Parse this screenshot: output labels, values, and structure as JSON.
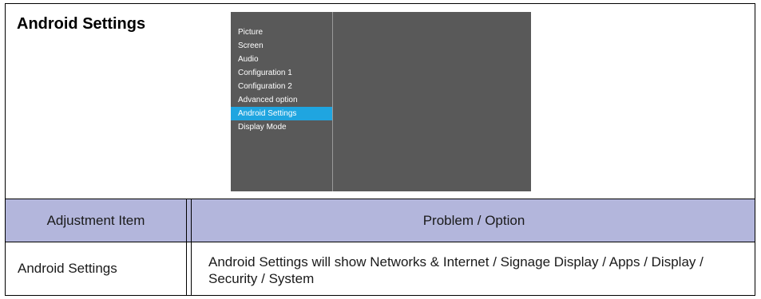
{
  "section": {
    "title": "Android Settings"
  },
  "osd_menu": {
    "items": [
      "Picture",
      "Screen",
      "Audio",
      "Configuration 1",
      "Configuration 2",
      "Advanced option",
      "Android Settings",
      "Display Mode"
    ],
    "selected": "Android Settings",
    "colors": {
      "panel": "#595959",
      "highlight": "#1fa5e0",
      "text": "#ffffff"
    }
  },
  "table": {
    "header": {
      "item": "Adjustment Item",
      "option": "Problem / Option",
      "color": "#b3b6dc"
    },
    "row": {
      "item": "Android Settings",
      "option": "Android Settings will show Networks & Internet / Signage Display / Apps / Display / Security / System"
    }
  }
}
